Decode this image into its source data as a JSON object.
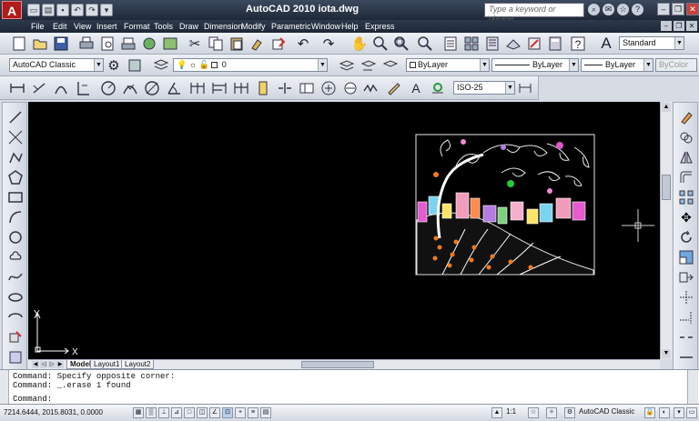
{
  "title_bar": {
    "app_logo": "A",
    "title": "AutoCAD 2010    iota.dwg",
    "search_placeholder": "Type a keyword or phrase"
  },
  "menu": {
    "items": [
      "File",
      "Edit",
      "View",
      "Insert",
      "Format",
      "Tools",
      "Draw",
      "Dimension",
      "Modify",
      "Parametric",
      "Window",
      "Help",
      "Express"
    ]
  },
  "toolbar_standard": {
    "text_style": "Standard"
  },
  "toolbar_workspace": {
    "workspace": "AutoCAD Classic",
    "layer": "0",
    "color": "ByLayer",
    "linetype": "ByLayer",
    "lineweight": "ByLayer",
    "plotstyle": "ByColor"
  },
  "toolbar_dimension": {
    "dimstyle": "ISO-25"
  },
  "layout_tabs": [
    "Model",
    "Layout1",
    "Layout2"
  ],
  "ucs": {
    "x_label": "X",
    "y_label": "Y"
  },
  "command_window": {
    "line1": "Command: Specify opposite corner:",
    "line2": "Command: _.erase 1 found",
    "prompt": "Command:"
  },
  "status_bar": {
    "coordinates": "7214.6444, 2015.8031, 0.0000",
    "annotation_scale": "1:1",
    "workspace": "AutoCAD Classic"
  },
  "colors": {
    "canvas": "#000000",
    "title_bar": "#1e2837",
    "logo_red": "#b01b1b"
  }
}
